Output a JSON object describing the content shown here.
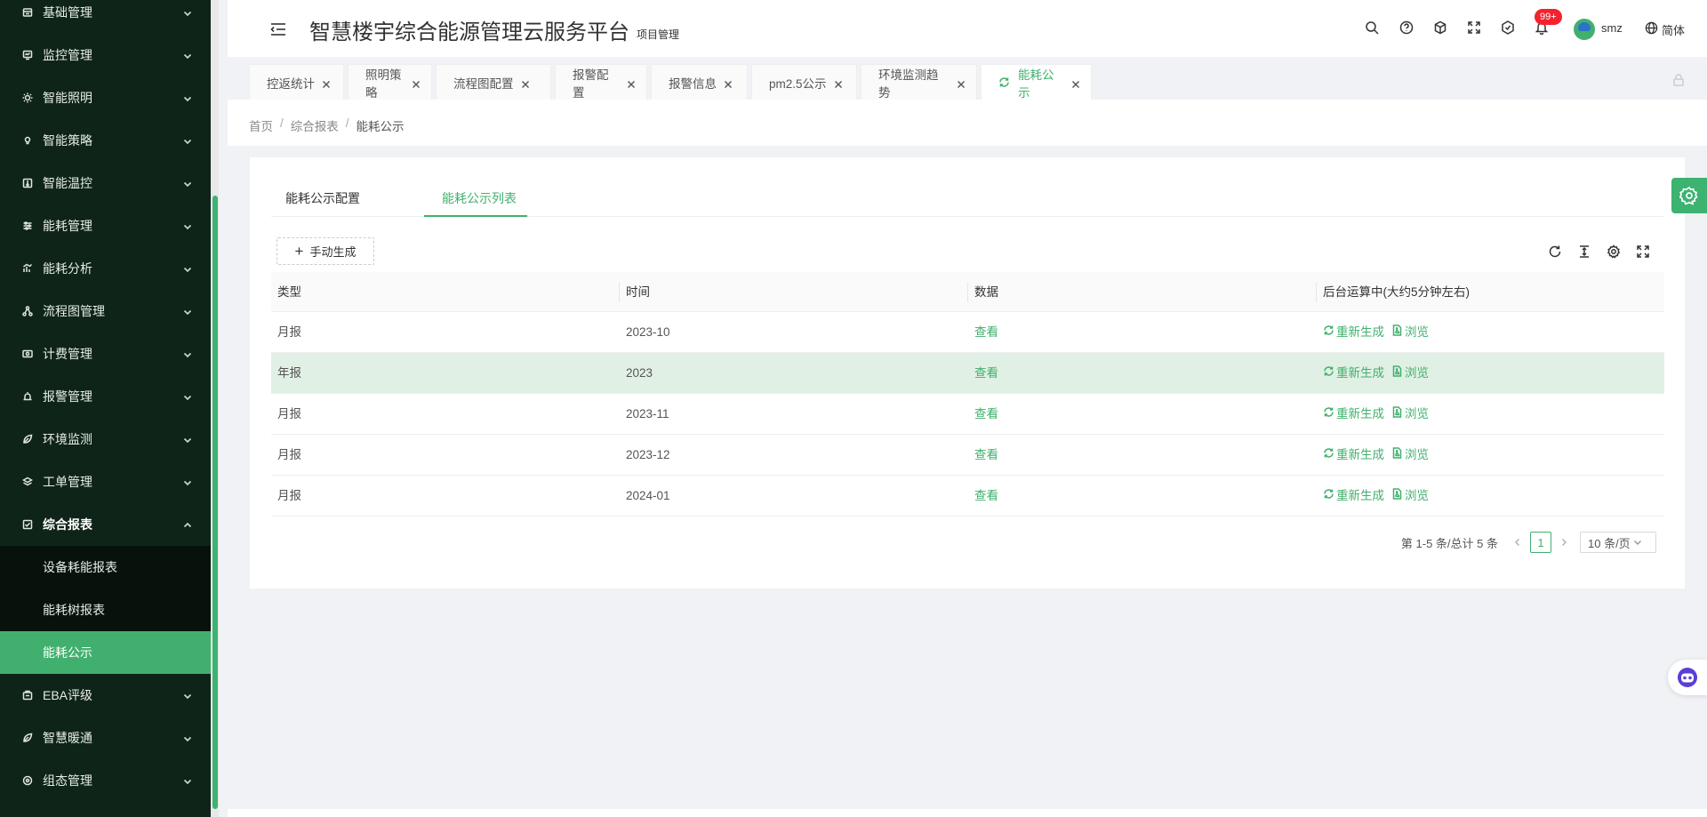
{
  "sidebar": {
    "items": [
      {
        "label": "基础管理",
        "icon": "database-icon"
      },
      {
        "label": "监控管理",
        "icon": "monitor-icon"
      },
      {
        "label": "智能照明",
        "icon": "sun-icon"
      },
      {
        "label": "智能策略",
        "icon": "bulb-icon"
      },
      {
        "label": "智能温控",
        "icon": "thermometer-icon"
      },
      {
        "label": "能耗管理",
        "icon": "sliders-icon"
      },
      {
        "label": "能耗分析",
        "icon": "bar-chart-icon"
      },
      {
        "label": "流程图管理",
        "icon": "flow-icon"
      },
      {
        "label": "计费管理",
        "icon": "money-icon"
      },
      {
        "label": "报警管理",
        "icon": "alarm-icon"
      },
      {
        "label": "环境监测",
        "icon": "leaf-icon"
      },
      {
        "label": "工单管理",
        "icon": "layers-icon"
      },
      {
        "label": "综合报表",
        "icon": "report-icon"
      },
      {
        "label": "EBA评级",
        "icon": "rating-icon"
      },
      {
        "label": "智慧暖通",
        "icon": "leaf-icon"
      },
      {
        "label": "组态管理",
        "icon": "config-icon"
      }
    ],
    "sub_items": [
      {
        "label": "设备耗能报表"
      },
      {
        "label": "能耗树报表"
      },
      {
        "label": "能耗公示"
      }
    ]
  },
  "header": {
    "title": "智慧楼宇综合能源管理云服务平台",
    "subtitle": "项目管理",
    "notification_count": "99+",
    "username": "smz",
    "language": "简体"
  },
  "tabs": [
    {
      "label": "控返统计"
    },
    {
      "label": "照明策略"
    },
    {
      "label": "流程图配置"
    },
    {
      "label": "报警配置"
    },
    {
      "label": "报警信息"
    },
    {
      "label": "pm2.5公示"
    },
    {
      "label": "环境监测趋势"
    },
    {
      "label": "能耗公示"
    }
  ],
  "breadcrumb": {
    "home": "首页",
    "section": "综合报表",
    "current": "能耗公示",
    "separator": "/"
  },
  "inner_tabs": [
    {
      "label": "能耗公示配置"
    },
    {
      "label": "能耗公示列表"
    }
  ],
  "toolbar": {
    "generate_label": "手动生成"
  },
  "table": {
    "columns": [
      "类型",
      "时间",
      "数据",
      "后台运算中(大约5分钟左右)"
    ],
    "rows": [
      {
        "type": "月报",
        "time": "2023-10",
        "data": "查看",
        "regen": "重新生成",
        "browse": "浏览"
      },
      {
        "type": "年报",
        "time": "2023",
        "data": "查看",
        "regen": "重新生成",
        "browse": "浏览"
      },
      {
        "type": "月报",
        "time": "2023-11",
        "data": "查看",
        "regen": "重新生成",
        "browse": "浏览"
      },
      {
        "type": "月报",
        "time": "2023-12",
        "data": "查看",
        "regen": "重新生成",
        "browse": "浏览"
      },
      {
        "type": "月报",
        "time": "2024-01",
        "data": "查看",
        "regen": "重新生成",
        "browse": "浏览"
      }
    ]
  },
  "pagination": {
    "total_text": "第 1-5 条/总计 5 条",
    "current_page": "1",
    "page_size": "10 条/页"
  },
  "colors": {
    "accent": "#41b06e",
    "sidebar_bg": "#0f2418",
    "row_highlight": "#e1f0e4",
    "badge": "#f5222d"
  }
}
